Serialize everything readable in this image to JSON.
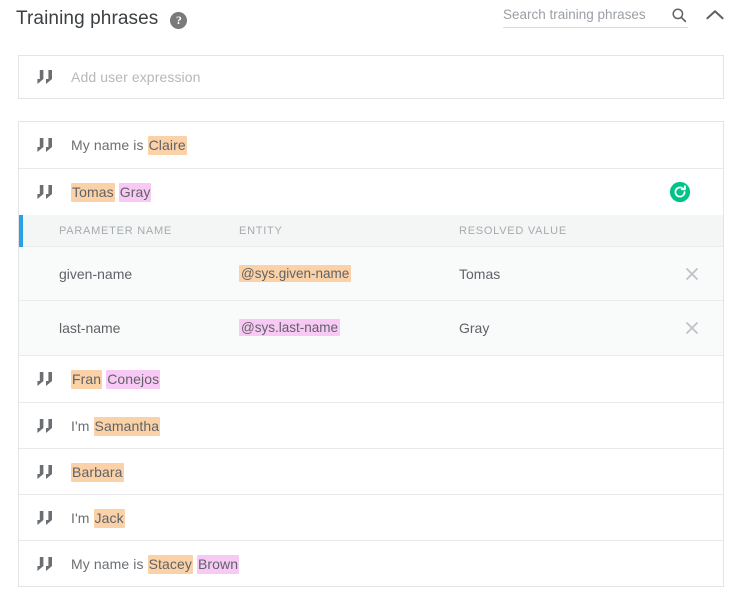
{
  "header": {
    "title": "Training phrases",
    "help_icon": "help-circle-icon",
    "search": {
      "placeholder": "Search training phrases",
      "value": "",
      "icon": "search-icon"
    },
    "collapse_icon": "chevron-up-icon"
  },
  "add_expression": {
    "placeholder": "Add user expression",
    "quote_icon": "quote-icon"
  },
  "colors": {
    "highlight_orange": "#fbd2a7",
    "highlight_pink": "#f9c9f5",
    "accent_blue": "#29a0e8",
    "reload_green": "#00c389",
    "text_gray": "#6b6f73",
    "placeholder_gray": "#b5b8bb"
  },
  "phrases": [
    {
      "id": "phrase-claire",
      "selected": false,
      "segments": [
        {
          "text": "My name is ",
          "highlight": "none"
        },
        {
          "text": "Claire",
          "highlight": "orange"
        }
      ]
    },
    {
      "id": "phrase-tomas-gray",
      "selected": true,
      "reload_icon": "reload-circle-icon",
      "segments": [
        {
          "text": "Tomas",
          "highlight": "orange"
        },
        {
          "text": " ",
          "highlight": "none"
        },
        {
          "text": "Gray",
          "highlight": "pink"
        }
      ],
      "parameters": {
        "columns": [
          "PARAMETER NAME",
          "ENTITY",
          "RESOLVED VALUE"
        ],
        "rows": [
          {
            "parameter_name": "given-name",
            "entity": "@sys.given-name",
            "entity_highlight": "orange",
            "resolved_value": "Tomas",
            "remove_icon": "close-icon"
          },
          {
            "parameter_name": "last-name",
            "entity": "@sys.last-name",
            "entity_highlight": "pink",
            "resolved_value": "Gray",
            "remove_icon": "close-icon"
          }
        ]
      }
    },
    {
      "id": "phrase-fran-conejos",
      "selected": false,
      "segments": [
        {
          "text": "Fran",
          "highlight": "orange"
        },
        {
          "text": " ",
          "highlight": "none"
        },
        {
          "text": "Conejos",
          "highlight": "pink"
        }
      ]
    },
    {
      "id": "phrase-samantha",
      "selected": false,
      "segments": [
        {
          "text": "I'm ",
          "highlight": "none"
        },
        {
          "text": "Samantha",
          "highlight": "orange"
        }
      ]
    },
    {
      "id": "phrase-barbara",
      "selected": false,
      "segments": [
        {
          "text": "Barbara",
          "highlight": "orange"
        }
      ]
    },
    {
      "id": "phrase-jack",
      "selected": false,
      "segments": [
        {
          "text": "I'm ",
          "highlight": "none"
        },
        {
          "text": "Jack",
          "highlight": "orange"
        }
      ]
    },
    {
      "id": "phrase-stacey-brown",
      "selected": false,
      "segments": [
        {
          "text": "My name is ",
          "highlight": "none"
        },
        {
          "text": "Stacey",
          "highlight": "orange"
        },
        {
          "text": " ",
          "highlight": "none"
        },
        {
          "text": "Brown",
          "highlight": "pink"
        }
      ]
    }
  ]
}
